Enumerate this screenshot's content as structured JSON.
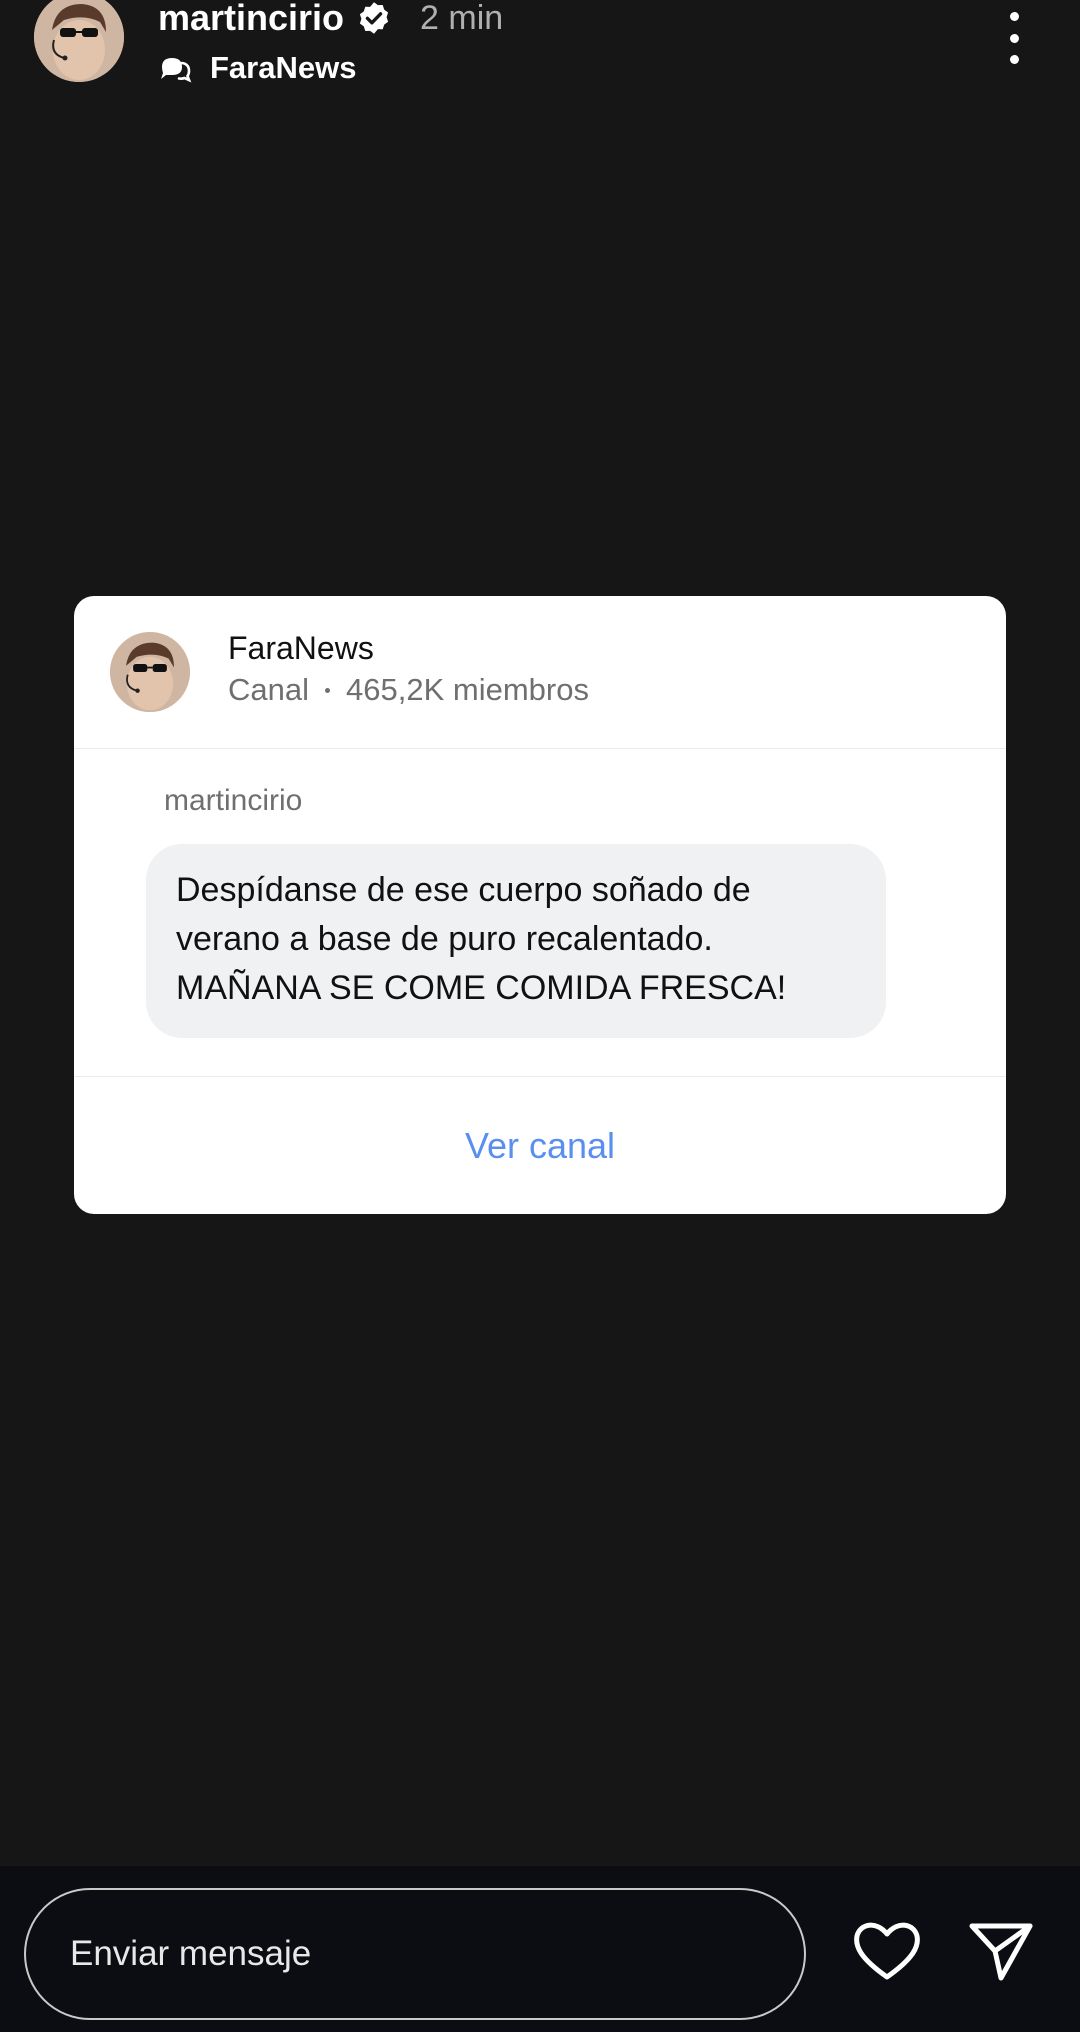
{
  "story": {
    "username": "martincirio",
    "time": "2 min",
    "channel_name": "FaraNews"
  },
  "card": {
    "title": "FaraNews",
    "subtitle_type": "Canal",
    "members": "465,2K miembros",
    "sender": "martincirio",
    "message_lines": [
      "Despídanse de ese cuerpo soñado de",
      "verano a base de puro recalentado.",
      "MAÑANA SE COME COMIDA FRESCA!"
    ],
    "action_label": "Ver canal"
  },
  "bottom_bar": {
    "input_placeholder": "Enviar mensaje"
  },
  "icons": {
    "verified": "verified-badge-icon",
    "channel": "broadcast-channel-icon",
    "more": "more-options-icon",
    "like": "heart-icon",
    "share": "send-icon"
  },
  "colors": {
    "background": "#161617",
    "card": "#ffffff",
    "link": "#5a8ff0",
    "bubble": "#f0f1f3",
    "bottom_bar": "#0b0d12"
  }
}
